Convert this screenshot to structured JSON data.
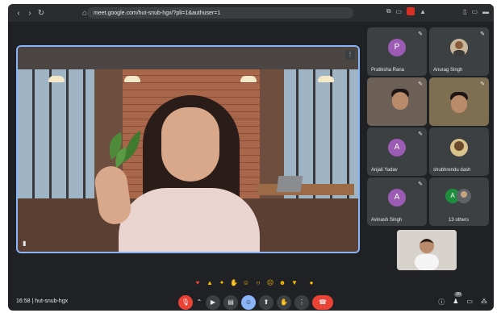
{
  "browser": {
    "url": "meet.google.com/hut-snub-hgx/?pli=1&authuser=1",
    "nav_icons": [
      "back-icon",
      "forward-icon",
      "reload-icon"
    ]
  },
  "main_video": {
    "more_icon": "more-vert-icon",
    "pin_icon": "pin-icon"
  },
  "participants": [
    {
      "name": "Pratiksha Rana",
      "initial": "P",
      "avatar_color": "#9c5bb5",
      "type": "initial"
    },
    {
      "name": "Anurag Singh",
      "initial": "",
      "type": "photo"
    },
    {
      "name": "",
      "type": "camera"
    },
    {
      "name": "",
      "type": "camera"
    },
    {
      "name": "Anjali Yadav",
      "initial": "A",
      "avatar_color": "#9c5bb5",
      "type": "initial"
    },
    {
      "name": "shubhrendu dash",
      "initial": "",
      "type": "photo"
    },
    {
      "name": "Avinash Singh",
      "initial": "A",
      "avatar_color": "#9c5bb5",
      "type": "initial"
    },
    {
      "name": "13 others",
      "initial": "A",
      "type": "others"
    }
  ],
  "reactions": [
    "heart",
    "thumbs-up",
    "party",
    "clap",
    "laugh",
    "surprised",
    "sad",
    "thinking",
    "thumbs-down",
    "raise-hand"
  ],
  "meeting": {
    "time": "16:58",
    "separator": "|",
    "code": "hut-snub-hgx",
    "people_count": "20"
  },
  "colors": {
    "background": "#202124",
    "tile": "#3c4043",
    "accent": "#8ab4f8",
    "danger": "#ea4335"
  }
}
